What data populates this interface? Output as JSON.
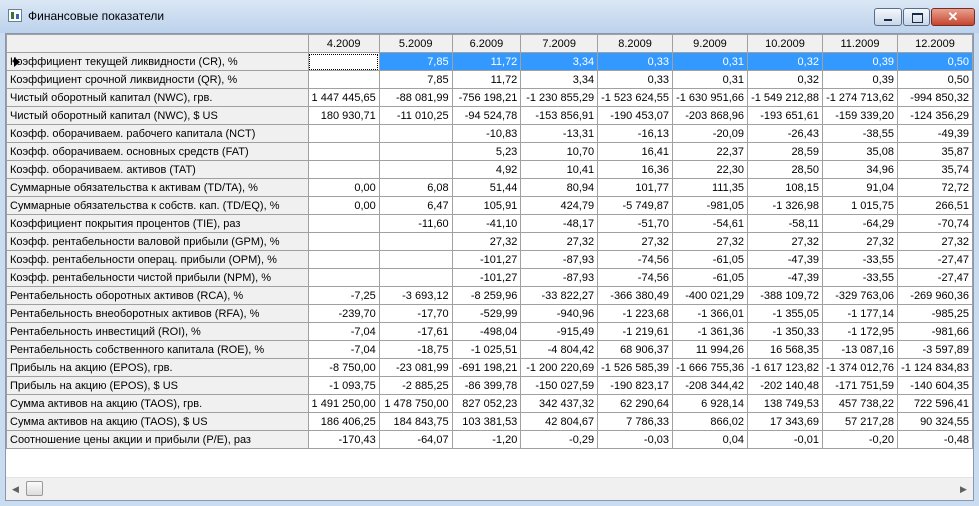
{
  "window": {
    "title": "Финансовые показатели"
  },
  "grid": {
    "columns": [
      "4.2009",
      "5.2009",
      "6.2009",
      "7.2009",
      "8.2009",
      "9.2009",
      "10.2009",
      "11.2009",
      "12.2009"
    ],
    "rows": [
      {
        "label": "Коэффициент текущей ликвидности (CR), %",
        "values": [
          "",
          "7,85",
          "11,72",
          "3,34",
          "0,33",
          "0,31",
          "0,32",
          "0,39",
          "0,50"
        ]
      },
      {
        "label": "Коэффициент срочной ликвидности (QR), %",
        "values": [
          "",
          "7,85",
          "11,72",
          "3,34",
          "0,33",
          "0,31",
          "0,32",
          "0,39",
          "0,50"
        ]
      },
      {
        "label": "Чистый оборотный капитал (NWC), грв.",
        "values": [
          "1 447 445,65",
          "-88 081,99",
          "-756 198,21",
          "-1 230 855,29",
          "-1 523 624,55",
          "-1 630 951,66",
          "-1 549 212,88",
          "-1 274 713,62",
          "-994 850,32"
        ]
      },
      {
        "label": "Чистый оборотный капитал (NWC), $ US",
        "values": [
          "180 930,71",
          "-11 010,25",
          "-94 524,78",
          "-153 856,91",
          "-190 453,07",
          "-203 868,96",
          "-193 651,61",
          "-159 339,20",
          "-124 356,29"
        ]
      },
      {
        "label": "Коэфф. оборачиваем. рабочего капитала (NCT)",
        "values": [
          "",
          "",
          "-10,83",
          "-13,31",
          "-16,13",
          "-20,09",
          "-26,43",
          "-38,55",
          "-49,39"
        ]
      },
      {
        "label": "Коэфф. оборачиваем. основных средств (FAT)",
        "values": [
          "",
          "",
          "5,23",
          "10,70",
          "16,41",
          "22,37",
          "28,59",
          "35,08",
          "35,87"
        ]
      },
      {
        "label": "Коэфф. оборачиваем. активов (TAT)",
        "values": [
          "",
          "",
          "4,92",
          "10,41",
          "16,36",
          "22,30",
          "28,50",
          "34,96",
          "35,74"
        ]
      },
      {
        "label": "Суммарные обязательства к активам (TD/TA), %",
        "values": [
          "0,00",
          "6,08",
          "51,44",
          "80,94",
          "101,77",
          "111,35",
          "108,15",
          "91,04",
          "72,72"
        ]
      },
      {
        "label": "Суммарные обязательства к собств. кап. (TD/EQ), %",
        "values": [
          "0,00",
          "6,47",
          "105,91",
          "424,79",
          "-5 749,87",
          "-981,05",
          "-1 326,98",
          "1 015,75",
          "266,51"
        ]
      },
      {
        "label": "Коэффициент покрытия процентов (TIE), раз",
        "values": [
          "",
          "-11,60",
          "-41,10",
          "-48,17",
          "-51,70",
          "-54,61",
          "-58,11",
          "-64,29",
          "-70,74"
        ]
      },
      {
        "label": "Коэфф. рентабельности валовой прибыли (GPM), %",
        "values": [
          "",
          "",
          "27,32",
          "27,32",
          "27,32",
          "27,32",
          "27,32",
          "27,32",
          "27,32"
        ]
      },
      {
        "label": "Коэфф. рентабельности операц. прибыли (OPM), %",
        "values": [
          "",
          "",
          "-101,27",
          "-87,93",
          "-74,56",
          "-61,05",
          "-47,39",
          "-33,55",
          "-27,47"
        ]
      },
      {
        "label": "Коэфф. рентабельности чистой прибыли (NPM), %",
        "values": [
          "",
          "",
          "-101,27",
          "-87,93",
          "-74,56",
          "-61,05",
          "-47,39",
          "-33,55",
          "-27,47"
        ]
      },
      {
        "label": "Рентабельность оборотных активов (RCA), %",
        "values": [
          "-7,25",
          "-3 693,12",
          "-8 259,96",
          "-33 822,27",
          "-366 380,49",
          "-400 021,29",
          "-388 109,72",
          "-329 763,06",
          "-269 960,36"
        ]
      },
      {
        "label": "Рентабельность внеоборотных активов (RFA), %",
        "values": [
          "-239,70",
          "-17,70",
          "-529,99",
          "-940,96",
          "-1 223,68",
          "-1 366,01",
          "-1 355,05",
          "-1 177,14",
          "-985,25"
        ]
      },
      {
        "label": "Рентабельность инвестиций (ROI), %",
        "values": [
          "-7,04",
          "-17,61",
          "-498,04",
          "-915,49",
          "-1 219,61",
          "-1 361,36",
          "-1 350,33",
          "-1 172,95",
          "-981,66"
        ]
      },
      {
        "label": "Рентабельность собственного капитала (ROE), %",
        "values": [
          "-7,04",
          "-18,75",
          "-1 025,51",
          "-4 804,42",
          "68 906,37",
          "11 994,26",
          "16 568,35",
          "-13 087,16",
          "-3 597,89"
        ]
      },
      {
        "label": "Прибыль на акцию (EPOS), грв.",
        "values": [
          "-8 750,00",
          "-23 081,99",
          "-691 198,21",
          "-1 200 220,69",
          "-1 526 585,39",
          "-1 666 755,36",
          "-1 617 123,82",
          "-1 374 012,76",
          "-1 124 834,83"
        ]
      },
      {
        "label": "Прибыль на акцию (EPOS), $ US",
        "values": [
          "-1 093,75",
          "-2 885,25",
          "-86 399,78",
          "-150 027,59",
          "-190 823,17",
          "-208 344,42",
          "-202 140,48",
          "-171 751,59",
          "-140 604,35"
        ]
      },
      {
        "label": "Сумма активов на акцию (TAOS), грв.",
        "values": [
          "1 491 250,00",
          "1 478 750,00",
          "827 052,23",
          "342 437,32",
          "62 290,64",
          "6 928,14",
          "138 749,53",
          "457 738,22",
          "722 596,41"
        ]
      },
      {
        "label": "Сумма активов на акцию (TAOS), $ US",
        "values": [
          "186 406,25",
          "184 843,75",
          "103 381,53",
          "42 804,67",
          "7 786,33",
          "866,02",
          "17 343,69",
          "57 217,28",
          "90 324,55"
        ]
      },
      {
        "label": "Соотношение цены акции и прибыли (P/E), раз",
        "values": [
          "-170,43",
          "-64,07",
          "-1,20",
          "-0,29",
          "-0,03",
          "0,04",
          "-0,01",
          "-0,20",
          "-0,48"
        ]
      }
    ]
  },
  "icons": {
    "window_icon": "chart-window-icon",
    "minimize": "minimize-icon",
    "maximize": "maximize-icon",
    "close": "close-icon",
    "scroll_left": "chevron-left-icon",
    "scroll_right": "chevron-right-icon",
    "row_pointer": "current-row-pointer-icon"
  },
  "colors": {
    "selection": "#3399ff",
    "titlebar": "#c9dcf0",
    "close_button": "#c6452e"
  }
}
